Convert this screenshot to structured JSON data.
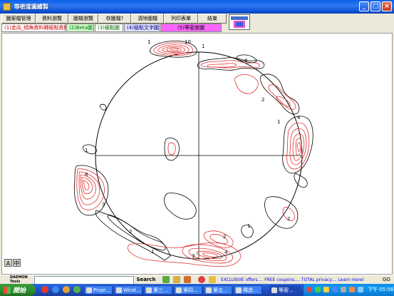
{
  "window": {
    "title": "等密度圖繪製"
  },
  "window_controls": {
    "min": "_",
    "max": "□",
    "close": "×"
  },
  "menu": [
    {
      "label": "圖案檔管理"
    },
    {
      "label": "資料瀏覽"
    },
    {
      "label": "圖檔瀏覽"
    },
    {
      "label": "存圖檔?"
    },
    {
      "label": "清除圖檔"
    },
    {
      "label": "列印表單"
    },
    {
      "label": "結束"
    }
  ],
  "tabs": [
    {
      "label": "(1)走向_傾角資料轉極點資料",
      "color": "#FFFFFF",
      "text_color": "#CC0000"
    },
    {
      "label": "(2)Beta圖",
      "color": "#CCFFCC",
      "text_color": "#006600"
    },
    {
      "label": "(3)極點圖",
      "color": "#FFFFFF",
      "text_color": "#006600"
    },
    {
      "label": "(4)極點文字圖",
      "color": "#E0E0FF",
      "text_color": "#000080"
    },
    {
      "label": "(5)等密度圖",
      "color": "#FF66FF",
      "text_color": "#000000"
    }
  ],
  "font_buttons": {
    "a": "A",
    "b": "中"
  },
  "contour_labels": {
    "top": "1",
    "top_peak": "10",
    "top_right": "4",
    "top_east": "2",
    "right_peak": "4",
    "right_one": "1",
    "left_one": "1",
    "left_peak": "8",
    "left_lower": "3",
    "left_side": "2",
    "lower_one": "1",
    "bottom_peak": "4",
    "bottom_two": "2",
    "bottom_three": "3",
    "right_lower": "1"
  },
  "search_toolbar": {
    "brand": "DAEMON Tools",
    "search_button": "Search",
    "ad_text": "EXCLUSIVE offers.... FREE coupons.... TOTAL privacy.... Learn more!",
    "go": "GO"
  },
  "taskbar": {
    "start": "開始",
    "tasks": [
      {
        "label": "Proje..."
      },
      {
        "label": "Wind..."
      },
      {
        "label": "第三..."
      },
      {
        "label": "第四..."
      },
      {
        "label": "第五..."
      },
      {
        "label": "構造..."
      },
      {
        "label": "等密..."
      }
    ],
    "clock": "下午 05:56"
  },
  "colors": {
    "contour_red": "#E03030",
    "contour_black": "#000000",
    "title_blue": "#0A5FE8"
  }
}
